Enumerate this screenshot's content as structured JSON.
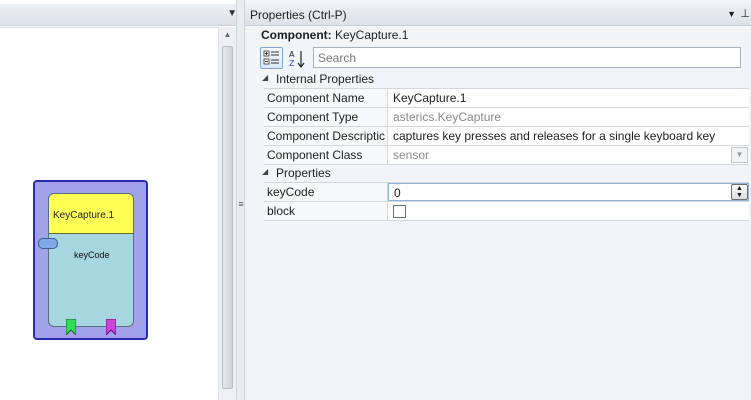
{
  "canvas": {
    "component": {
      "title": "KeyCapture.1",
      "input_port_label": "keyCode",
      "colors": {
        "outer": "#a2a2ea",
        "outer_border": "#2b2bb8",
        "body": "#a6d6e0",
        "title_bg": "#ffff55",
        "input_port": "#7fa8e6",
        "output_port_1": "#33dd55",
        "output_port_2": "#cc44dd"
      }
    }
  },
  "properties_panel": {
    "title": "Properties (Ctrl-P)",
    "component_label": "Component:",
    "component_name": "KeyCapture.1",
    "search_placeholder": "Search",
    "categories": [
      {
        "name": "Internal Properties",
        "rows": [
          {
            "name": "Component Name",
            "value": "KeyCapture.1",
            "readonly": false
          },
          {
            "name": "Component Type",
            "value": "asterics.KeyCapture",
            "readonly": true
          },
          {
            "name": "Component Descriptic",
            "value": "captures key presses and releases for a single keyboard key",
            "readonly": false
          },
          {
            "name": "Component Class",
            "value": "sensor",
            "readonly": true
          }
        ]
      },
      {
        "name": "Properties",
        "rows": [
          {
            "name": "keyCode",
            "value": "0"
          },
          {
            "name": "block",
            "checked": false
          }
        ]
      }
    ]
  }
}
